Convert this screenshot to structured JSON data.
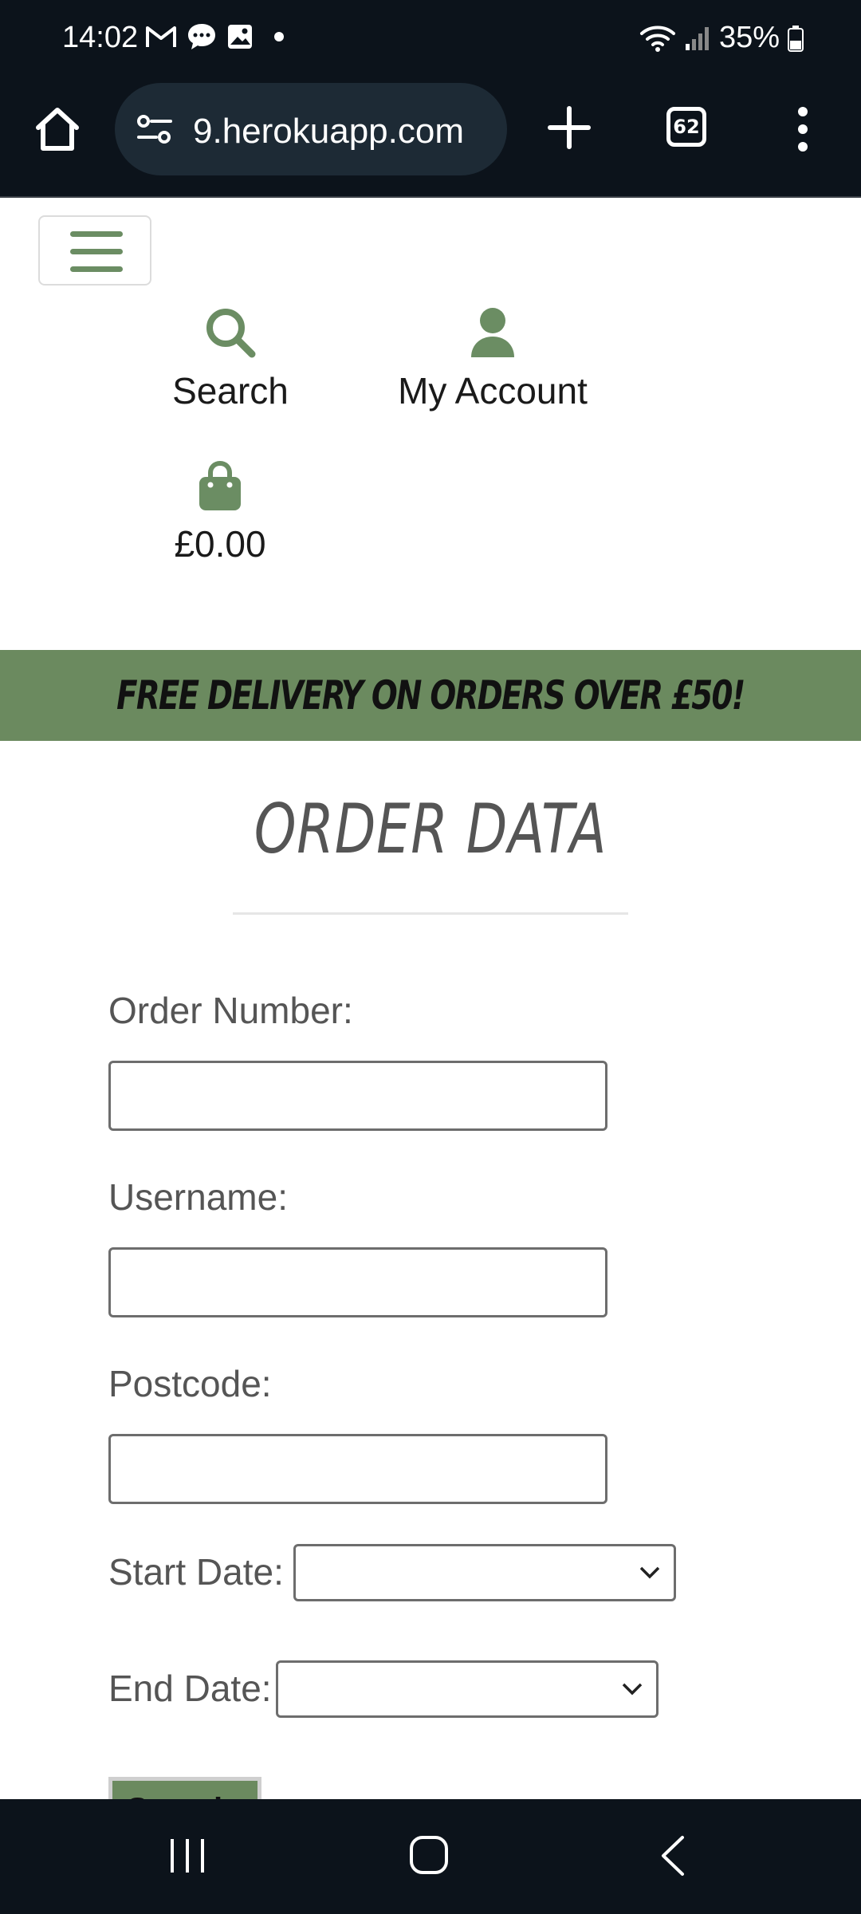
{
  "status_bar": {
    "time": "14:02",
    "notification_icons": [
      "gmail-icon",
      "chat-icon",
      "gallery-icon",
      "dot-icon"
    ],
    "battery": "35%"
  },
  "browser": {
    "url": "9.herokuapp.com",
    "tab_count": "62"
  },
  "header": {
    "nav": {
      "search_label": "Search",
      "account_label": "My Account",
      "bag_total": "£0.00"
    },
    "brand_color": "#6b8a5f"
  },
  "banner": {
    "text": "FREE DELIVERY ON ORDERS OVER £50!"
  },
  "page": {
    "title": "ORDER DATA"
  },
  "form": {
    "order_number_label": "Order Number:",
    "order_number_value": "",
    "username_label": "Username:",
    "username_value": "",
    "postcode_label": "Postcode:",
    "postcode_value": "",
    "start_date_label": "Start Date:",
    "start_date_value": "",
    "end_date_label": "End Date:",
    "end_date_value": "",
    "submit_label": "Search"
  }
}
